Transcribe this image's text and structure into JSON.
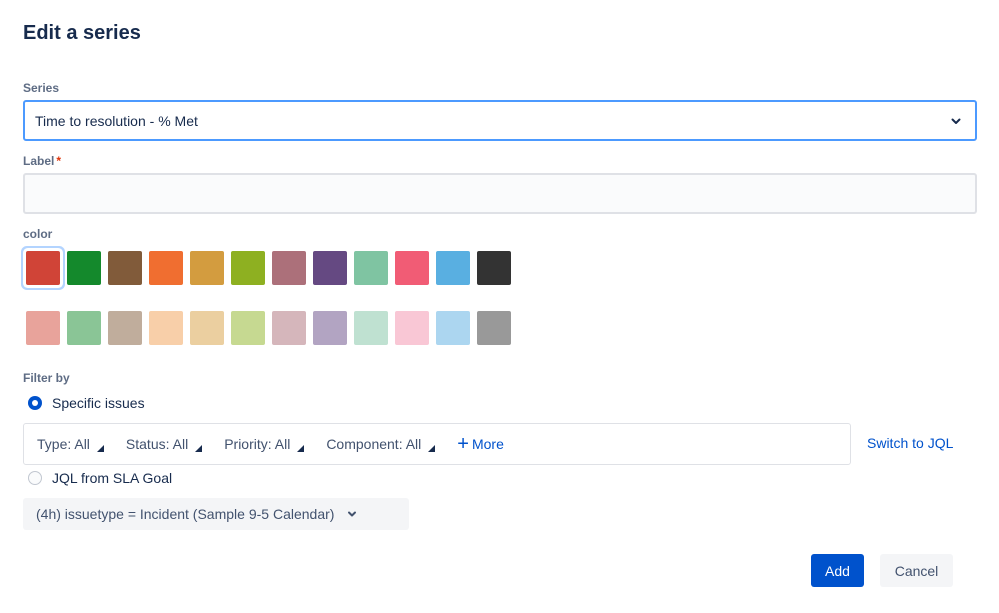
{
  "dialog": {
    "title": "Edit a series"
  },
  "series": {
    "label": "Series",
    "value": "Time to resolution - % Met"
  },
  "label_field": {
    "label": "Label",
    "required_marker": "*",
    "value": ""
  },
  "color": {
    "label": "color",
    "selected_index": 0,
    "row1": [
      "#d04437",
      "#14892c",
      "#815b3a",
      "#f06e30",
      "#d39c3f",
      "#8eb021",
      "#ac707a",
      "#654982",
      "#7fc4a2",
      "#f15c75",
      "#59afe1",
      "#333333"
    ],
    "row2": [
      "#e8a39b",
      "#8ac596",
      "#c0ad9c",
      "#f8cfa9",
      "#ebcfa0",
      "#c6d991",
      "#d5b6bb",
      "#b2a4c2",
      "#bfe1d1",
      "#f9c7d5",
      "#acd6f0",
      "#999999"
    ]
  },
  "filter": {
    "label": "Filter by",
    "specific_issues_label": "Specific issues",
    "items": [
      "Type: All",
      "Status: All",
      "Priority: All",
      "Component: All"
    ],
    "more_label": "More",
    "switch_label": "Switch to JQL",
    "jql_label": "JQL from SLA Goal",
    "goal_value": "(4h) issuetype = Incident (Sample 9-5 Calendar)"
  },
  "actions": {
    "add_label": "Add",
    "cancel_label": "Cancel"
  }
}
